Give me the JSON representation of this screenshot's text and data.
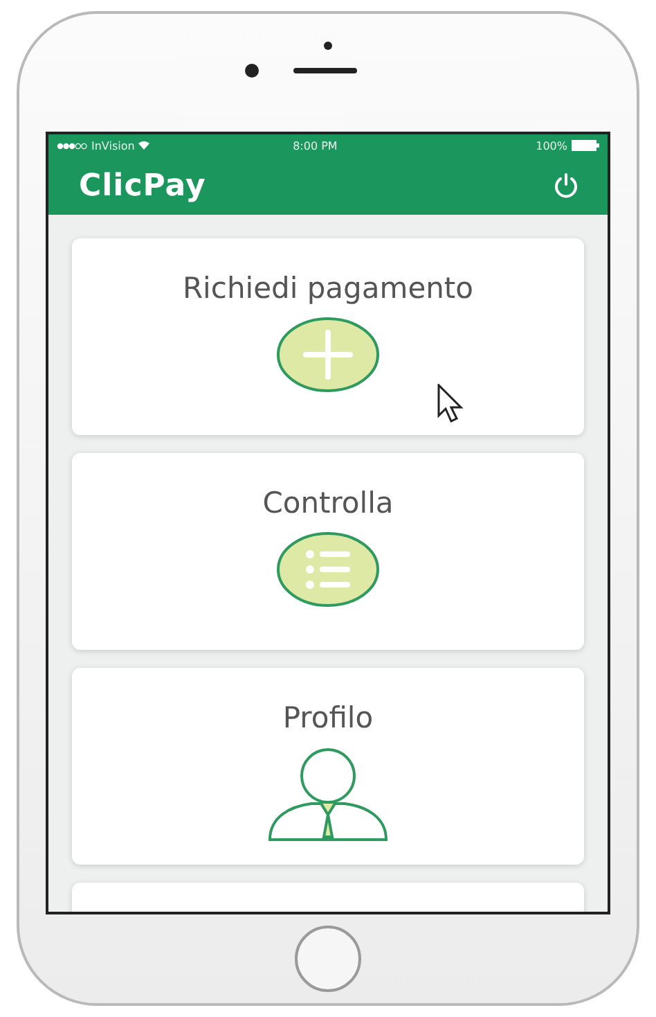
{
  "status_bar": {
    "carrier": "InVision",
    "time": "8:00 PM",
    "battery": "100%"
  },
  "header": {
    "title": "ClicPay"
  },
  "cards": [
    {
      "label": "Richiedi pagamento",
      "kind": "add"
    },
    {
      "label": "Controlla",
      "kind": "list"
    },
    {
      "label": "Profilo",
      "kind": "profile"
    }
  ]
}
